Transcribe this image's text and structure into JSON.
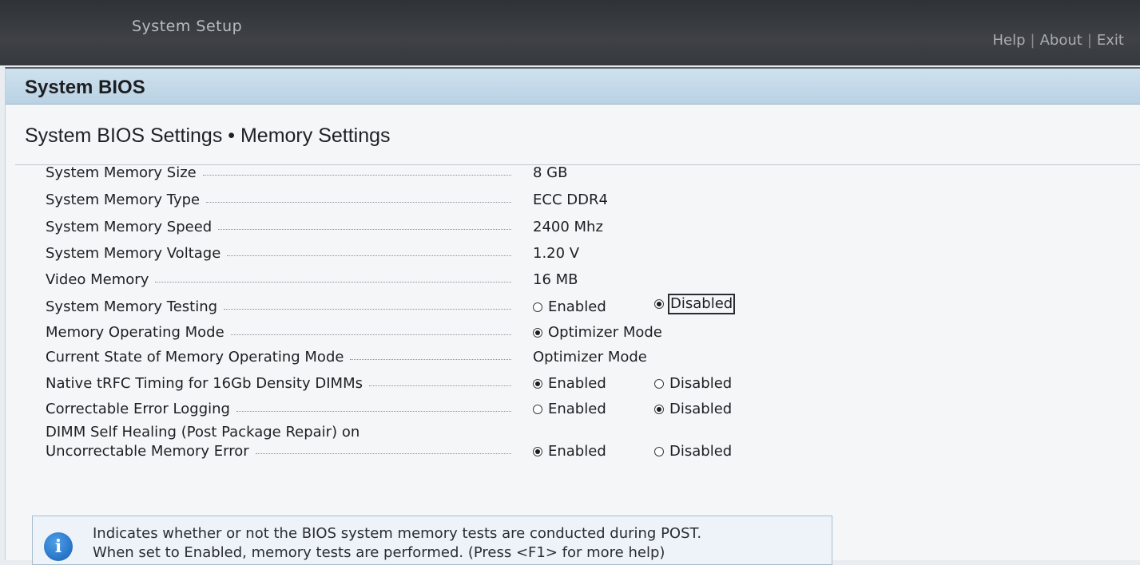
{
  "topbar": {
    "app_title": "System Setup",
    "links": [
      "Help",
      "About",
      "Exit"
    ],
    "separator": "|"
  },
  "bios_header": {
    "title": "System BIOS"
  },
  "page_title": "System BIOS Settings • Memory Settings",
  "settings": [
    {
      "label": "System Memory Size",
      "value": "8 GB"
    },
    {
      "label": "System Memory Type",
      "value": "ECC DDR4"
    },
    {
      "label": "System Memory Speed",
      "value": "2400 Mhz"
    },
    {
      "label": "System Memory Voltage",
      "value": "1.20 V"
    },
    {
      "label": "Video Memory",
      "value": "16 MB"
    },
    {
      "label": "System Memory Testing",
      "options": [
        "Enabled",
        "Disabled"
      ],
      "selected": "Disabled",
      "focused": "Disabled"
    },
    {
      "label": "Memory Operating Mode",
      "options": [
        "Optimizer Mode"
      ],
      "selected": "Optimizer Mode"
    },
    {
      "label": "Current State of Memory Operating Mode",
      "value": "Optimizer Mode"
    },
    {
      "label": "Native tRFC Timing for 16Gb Density DIMMs",
      "options": [
        "Enabled",
        "Disabled"
      ],
      "selected": "Enabled"
    },
    {
      "label": "Correctable Error Logging",
      "options": [
        "Enabled",
        "Disabled"
      ],
      "selected": "Disabled"
    },
    {
      "label_line1": "DIMM Self Healing (Post Package Repair) on",
      "label": "Uncorrectable Memory Error",
      "options": [
        "Enabled",
        "Disabled"
      ],
      "selected": "Enabled"
    }
  ],
  "help": {
    "icon": "info-icon",
    "line1": "Indicates whether or not the BIOS system memory tests are conducted during POST.",
    "line2": "When set to Enabled, memory tests are performed. (Press <F1> for more help)"
  }
}
